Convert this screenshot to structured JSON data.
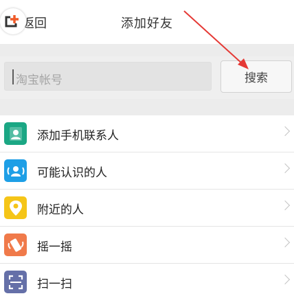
{
  "header": {
    "back_label": "返回",
    "back_visible": "返回",
    "title": "添加好友"
  },
  "search": {
    "placeholder": "淘宝帐号",
    "button_label": "搜索"
  },
  "menu": [
    {
      "label": "添加手机联系人",
      "icon": "contact-card-icon",
      "color": "#1ba784"
    },
    {
      "label": "可能认识的人",
      "icon": "people-icon",
      "color": "#1e9fe6"
    },
    {
      "label": "附近的人",
      "icon": "location-pin-icon",
      "color": "#f5c518"
    },
    {
      "label": "摇一摇",
      "icon": "shake-phone-icon",
      "color": "#f07a4a"
    },
    {
      "label": "扫一扫",
      "icon": "scan-icon",
      "color": "#6570a8"
    }
  ],
  "colors": {
    "annotation_arrow": "#e53935",
    "badge_accent": "#f05a28"
  }
}
